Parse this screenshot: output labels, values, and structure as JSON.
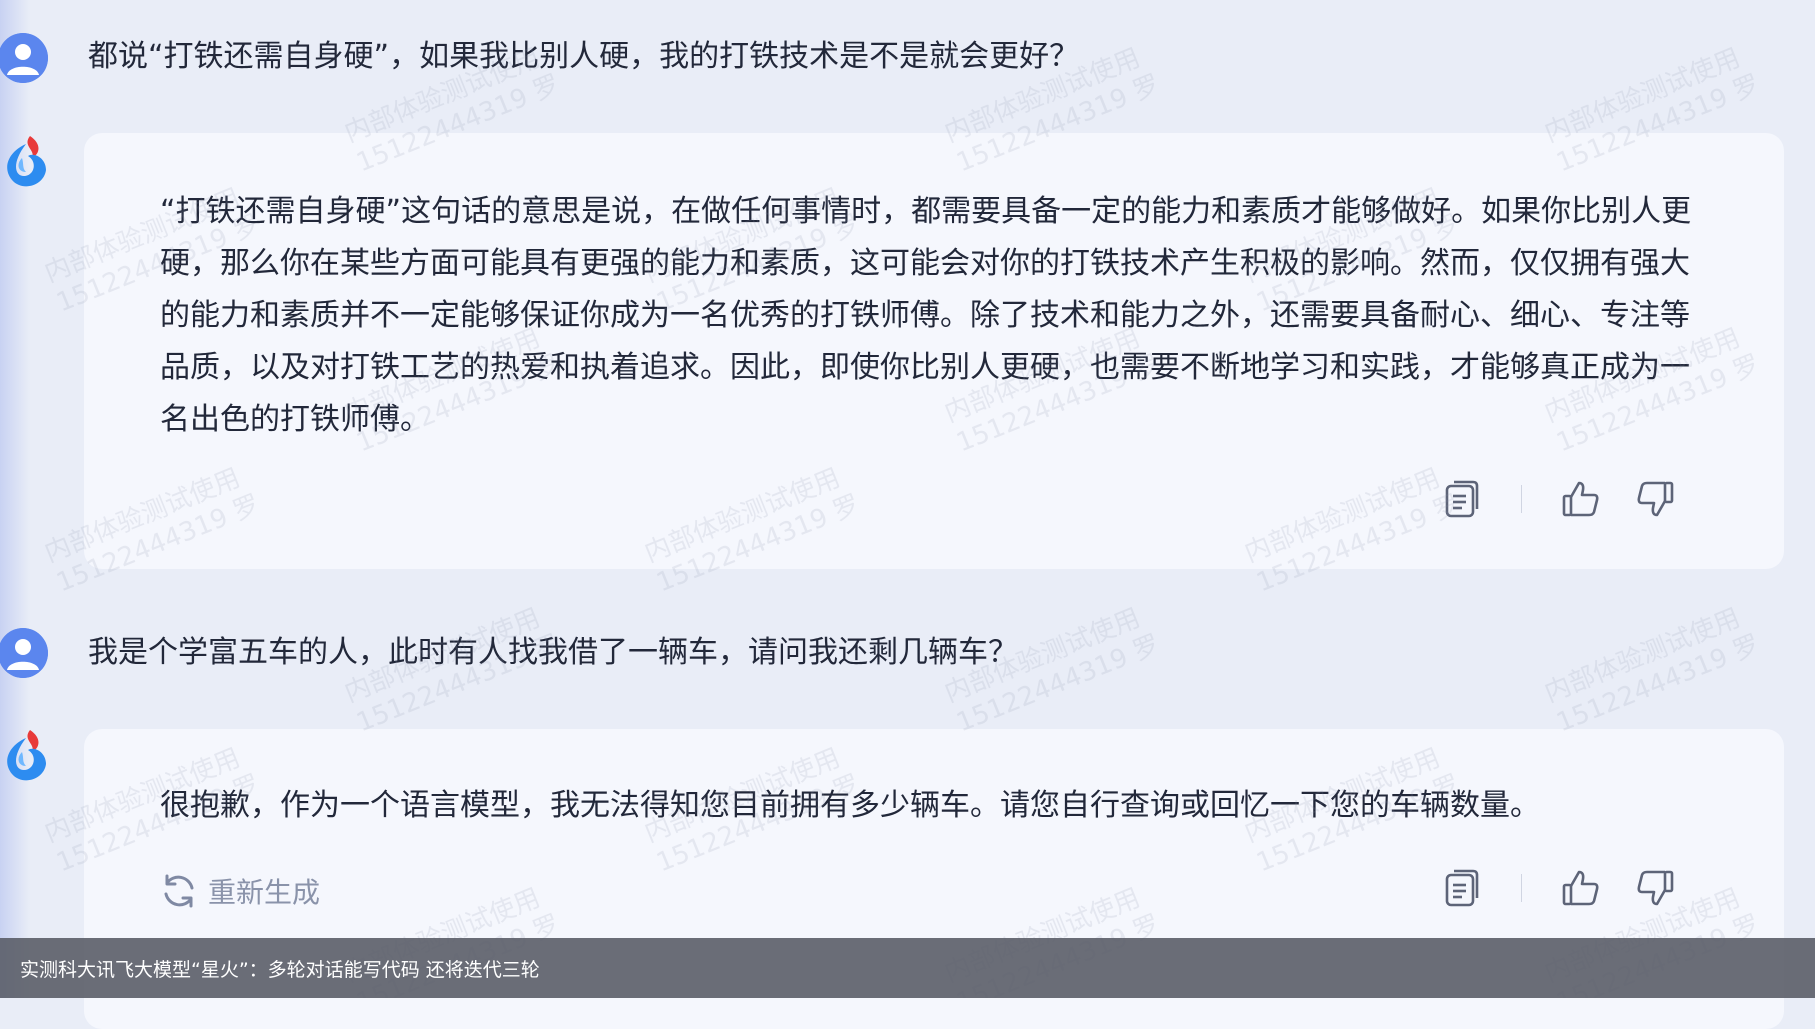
{
  "conversation": [
    {
      "role": "user",
      "text": "都说“打铁还需自身硬”，如果我比别人硬，我的打铁技术是不是就会更好？"
    },
    {
      "role": "assistant",
      "paragraph": "“打铁还需自身硬”这句话的意思是说，在做任何事情时，都需要具备一定的能力和素质才能够做好。如果你比别人更硬，那么你在某些方面可能具有更强的能力和素质，这可能会对你的打铁技术产生积极的影响。然而，仅仅拥有强大的能力和素质并不一定能够保证你成为一名优秀的打铁师傅。除了技术和能力之外，还需要具备耐心、细心、专注等品质，以及对打铁工艺的热爱和执着追求。因此，即使你比别人更硬，也需要不断地学习和实践，才能够真正成为一名出色的打铁师傅。",
      "actions": [
        "copy-icon",
        "thumbs-up-icon",
        "thumbs-down-icon"
      ]
    },
    {
      "role": "user",
      "text": "我是个学富五车的人，此时有人找我借了一辆车，请问我还剩几辆车？"
    },
    {
      "role": "assistant",
      "paragraph": "很抱歉，作为一个语言模型，我无法得知您目前拥有多少辆车。请您自行查询或回忆一下您的车辆数量。",
      "actions": [
        "copy-icon",
        "thumbs-up-icon",
        "thumbs-down-icon"
      ],
      "regenerate_label": "重新生成"
    }
  ],
  "watermark": {
    "line1": "内部体验测试使用",
    "line2": "15122444319 罗"
  },
  "caption": "实测科大讯飞大模型“星火”：多轮对话能写代码  还将迭代三轮",
  "colors": {
    "page_bg": "#e9edf7",
    "card_bg": "#f5f7fd",
    "user_avatar": "#5b86ee",
    "bot_flame_red": "#e83a3a",
    "bot_flame_blue": "#2d8cf0",
    "icon_gray": "#5d6478",
    "caption_bg": "#565a64"
  }
}
